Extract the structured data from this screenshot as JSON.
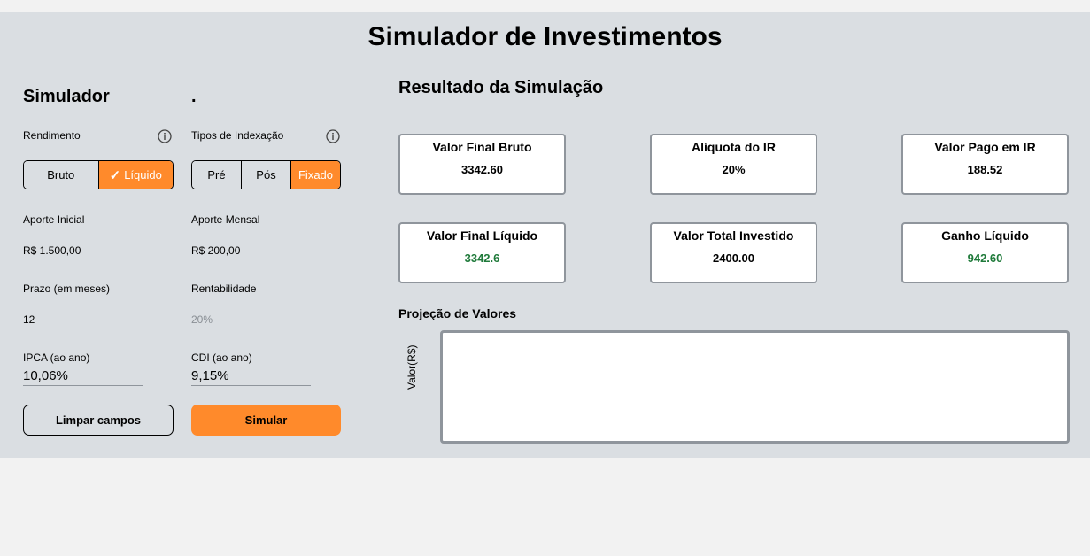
{
  "app_title": "Simulador de Investimentos",
  "simulator": {
    "title": "Simulador",
    "dot": ".",
    "rendimento": {
      "label": "Rendimento",
      "info_icon": "info-icon",
      "options": [
        "Bruto",
        "Líquido"
      ],
      "selected": "Líquido",
      "check_glyph": "✓"
    },
    "indexacao": {
      "label": "Tipos de Indexação",
      "info_icon": "info-icon",
      "options": [
        "Pré",
        "Pós",
        "Fixado"
      ],
      "selected": "Fixado"
    },
    "aporte_inicial": {
      "label": "Aporte Inicial",
      "value": "R$ 1.500,00"
    },
    "aporte_mensal": {
      "label": "Aporte Mensal",
      "value": "R$ 200,00"
    },
    "prazo": {
      "label": "Prazo (em meses)",
      "value": "12"
    },
    "rentabilidade": {
      "label": "Rentabilidade",
      "value": "20%"
    },
    "ipca": {
      "label": "IPCA (ao ano)",
      "value": "10,06%"
    },
    "cdi": {
      "label": "CDI (ao ano)",
      "value": "9,15%"
    },
    "clear_button": "Limpar campos",
    "simulate_button": "Simular"
  },
  "results": {
    "title": "Resultado da Simulação",
    "cards": [
      {
        "title": "Valor Final Bruto",
        "value": "3342.60"
      },
      {
        "title": "Alíquota do IR",
        "value": "20%"
      },
      {
        "title": "Valor Pago em IR",
        "value": "188.52"
      },
      {
        "title": "Valor Final Líquido",
        "value": "3342.6"
      },
      {
        "title": "Valor Total Investido",
        "value": "2400.00"
      },
      {
        "title": "Ganho Líquido",
        "value": "942.60"
      }
    ],
    "projection": {
      "title": "Projeção de Valores",
      "ylabel": "Valor(R$)"
    }
  },
  "colors": {
    "accent": "#ff8a2b",
    "panel": "#dadee2",
    "positive": "#1f7a3a"
  }
}
